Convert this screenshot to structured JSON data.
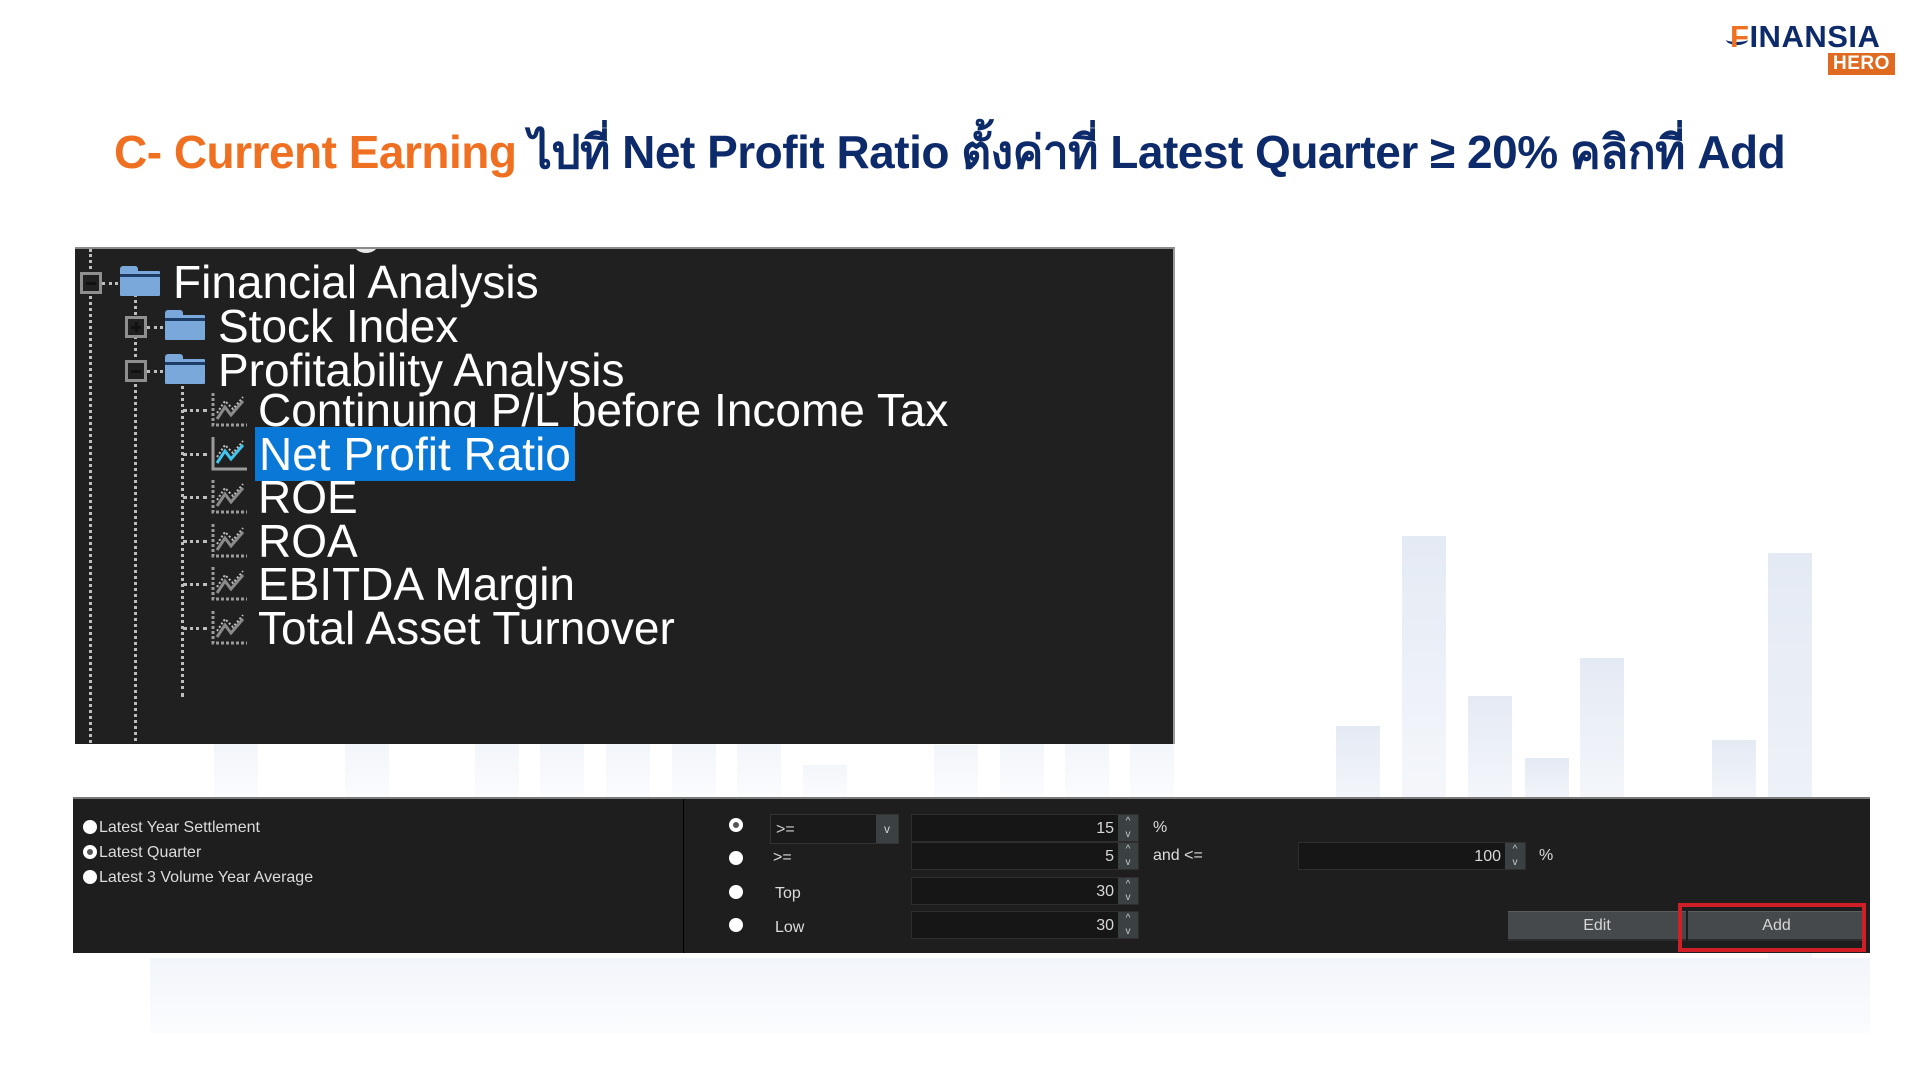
{
  "logo": {
    "first_letter": "F",
    "name_rest": "INANSIA",
    "badge": "HERO"
  },
  "title": {
    "accent": "C- Current Earning",
    "rest": " ไปที่ Net Profit Ratio ตั้งค่าที่ Latest Quarter ≥ 20% คลิกที่ Add"
  },
  "colors": {
    "accent_orange": "#f07022",
    "navy": "#0d2a6b",
    "selection_blue": "#0a78d6",
    "highlight_red": "#d01f27"
  },
  "tree": {
    "root": {
      "label": "Financial Analysis",
      "expanded": true,
      "icon": "folder-icon"
    },
    "children": [
      {
        "label": "Stock Index",
        "expanded": false,
        "icon": "folder-icon"
      },
      {
        "label": "Profitability Analysis",
        "expanded": true,
        "icon": "folder-icon",
        "items": [
          {
            "label": "Continuing P/L before Income Tax",
            "icon": "line-chart-icon",
            "selected": false
          },
          {
            "label": "Net Profit Ratio",
            "icon": "line-chart-icon",
            "selected": true
          },
          {
            "label": "ROE",
            "icon": "line-chart-icon",
            "selected": false
          },
          {
            "label": "ROA",
            "icon": "line-chart-icon",
            "selected": false
          },
          {
            "label": "EBITDA Margin",
            "icon": "line-chart-icon",
            "selected": false
          },
          {
            "label": "Total Asset Turnover",
            "icon": "line-chart-icon",
            "selected": false
          }
        ]
      }
    ]
  },
  "period_options": [
    {
      "label": "Latest Year Settlement",
      "checked": false
    },
    {
      "label": "Latest Quarter",
      "checked": true
    },
    {
      "label": "Latest 3 Volume Year Average",
      "checked": false
    }
  ],
  "conditions": [
    {
      "checked": true,
      "operator_select": ">=",
      "value": "15",
      "unit": "%"
    },
    {
      "checked": false,
      "operator_label": ">=",
      "value": "5",
      "between_label": "and <=",
      "value2": "100",
      "unit": "%"
    },
    {
      "checked": false,
      "label": "Top",
      "value": "30"
    },
    {
      "checked": false,
      "label": "Low",
      "value": "30"
    }
  ],
  "stepper": {
    "up": "^",
    "down": "v"
  },
  "select_arrow": "v",
  "buttons": {
    "edit": "Edit",
    "add": "Add"
  }
}
